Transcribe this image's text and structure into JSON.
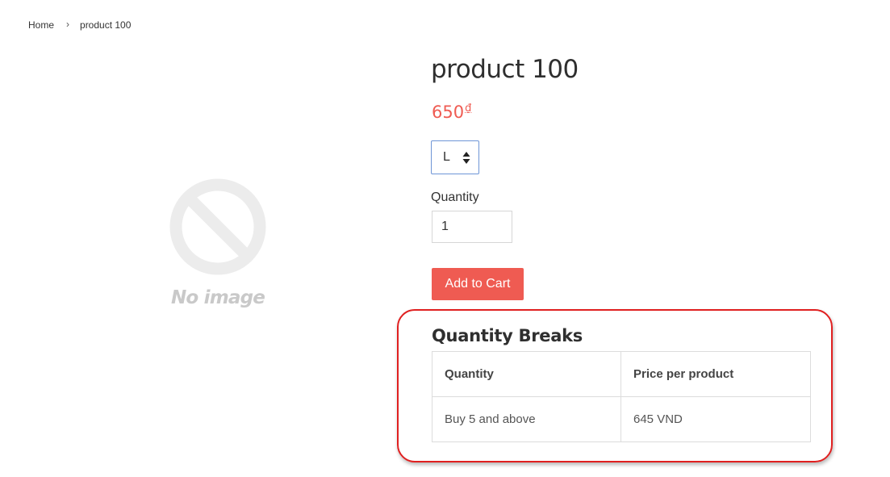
{
  "breadcrumb": {
    "home": "Home",
    "separator": "›",
    "current": "product 100"
  },
  "image": {
    "placeholder_text": "No image",
    "icon": "no-image-icon"
  },
  "product": {
    "title": "product 100",
    "price": "650",
    "currency_symbol": "₫",
    "variant_selected": "L",
    "quantity_label": "Quantity",
    "quantity_value": "1",
    "add_to_cart_label": "Add to Cart"
  },
  "quantity_breaks": {
    "title": "Quantity Breaks",
    "columns": [
      "Quantity",
      "Price per product"
    ],
    "rows": [
      [
        "Buy 5 and above",
        "645 VND"
      ]
    ]
  },
  "colors": {
    "accent": "#ef5b52",
    "highlight_border": "#e02020",
    "select_border": "#6e95d6"
  }
}
